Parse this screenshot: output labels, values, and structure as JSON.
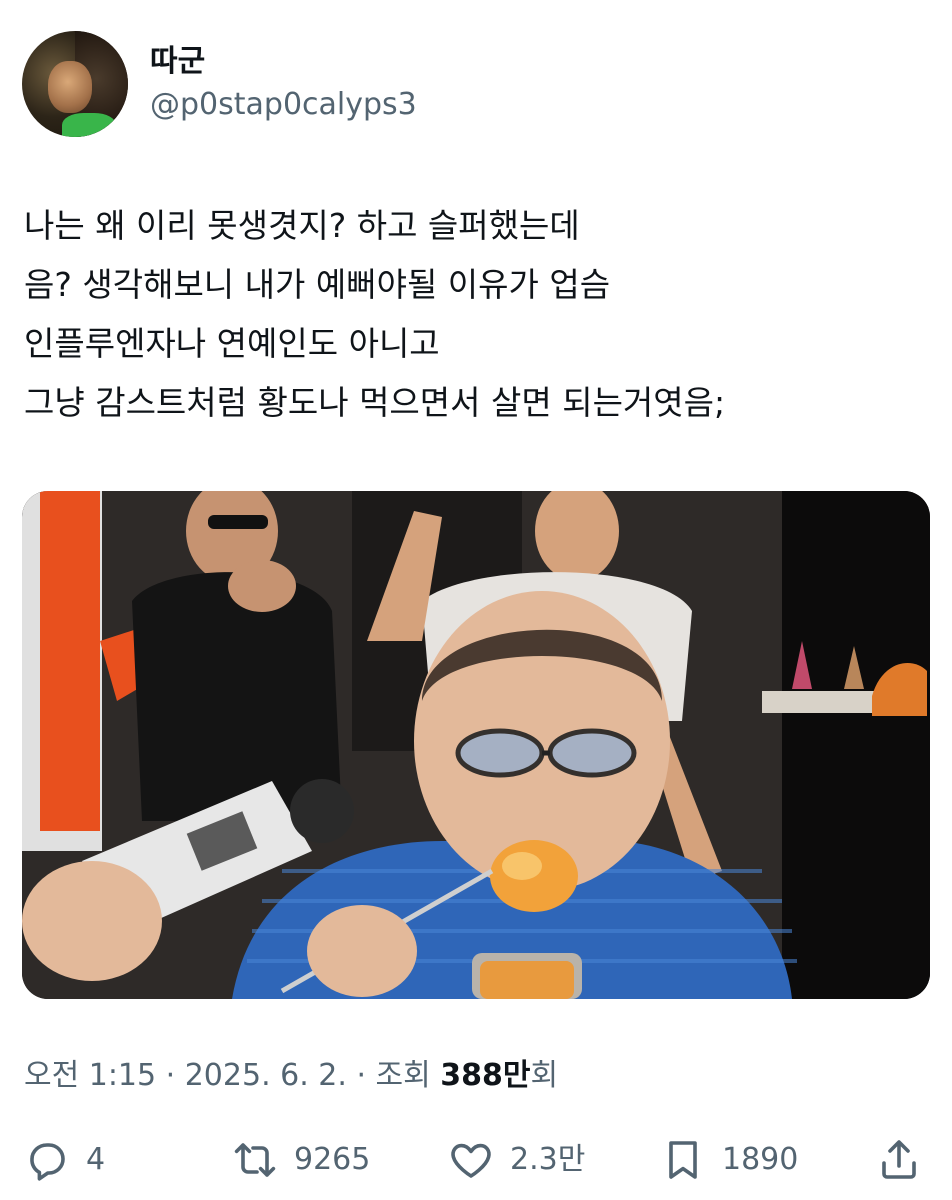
{
  "author": {
    "display_name": "따군",
    "handle": "@p0stap0calyps3"
  },
  "tweet": {
    "lines": [
      "나는 왜 이리 못생겻지? 하고 슬퍼했는데",
      "음? 생각해보니 내가 예뻐야될 이유가 업슴",
      "인플루엔자나 연예인도 아니고",
      "그냥 감스트처럼 황도나 먹으면서 살면 되는거엿음;"
    ]
  },
  "meta": {
    "time": "오전 1:15",
    "separator": " · ",
    "date": "2025. 6. 2.",
    "views_label": "조회 ",
    "views_value": "388만",
    "views_suffix": "회"
  },
  "actions": {
    "reply_count": "4",
    "repost_count": "9265",
    "like_count": "2.3만",
    "bookmark_count": "1890"
  },
  "icons": {
    "reply": "reply-icon",
    "repost": "repost-icon",
    "like": "heart-icon",
    "bookmark": "bookmark-icon",
    "share": "share-icon"
  },
  "colors": {
    "text": "#0f1419",
    "secondary": "#536471"
  }
}
